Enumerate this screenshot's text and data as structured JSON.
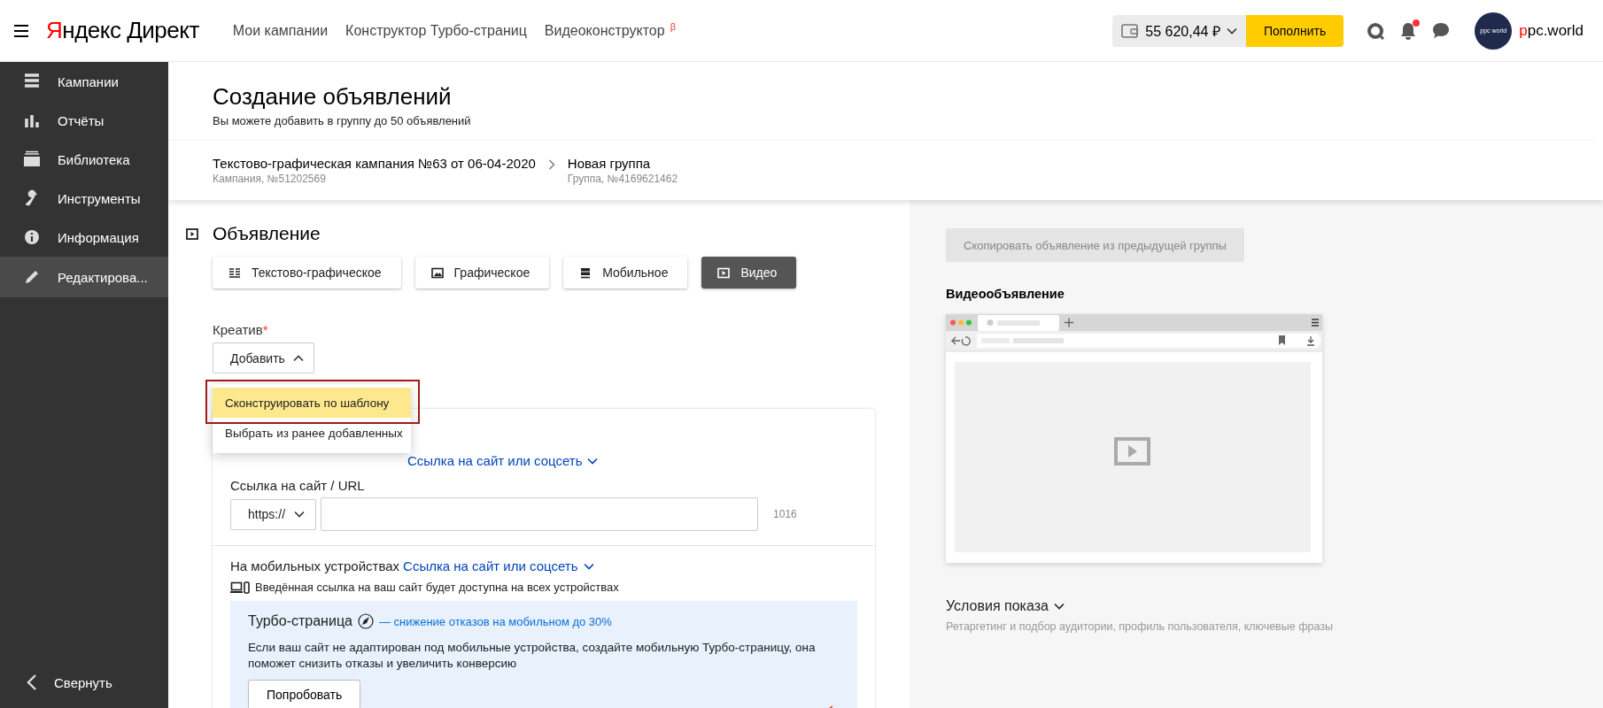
{
  "header": {
    "logo": {
      "accent": "Я",
      "rest": "ндекс Директ"
    },
    "nav": [
      {
        "label": "Мои кампании"
      },
      {
        "label": "Конструктор Турбо-страниц"
      },
      {
        "label": "Видеоконструктор",
        "beta": "β"
      }
    ],
    "balance": "55 620,44 ₽",
    "topup_button": "Пополнить",
    "notifications_unread": true,
    "avatar_text": "ppc world",
    "user": {
      "accent": "p",
      "rest": "pc.world"
    }
  },
  "sidebar": {
    "items": [
      {
        "label": "Кампании",
        "selected": false
      },
      {
        "label": "Отчёты",
        "selected": false
      },
      {
        "label": "Библиотека",
        "selected": false
      },
      {
        "label": "Инструменты",
        "selected": false
      },
      {
        "label": "Информация",
        "selected": false
      },
      {
        "label": "Редактирова...",
        "selected": true
      }
    ],
    "collapse": "Свернуть"
  },
  "page": {
    "title": "Создание объявлений",
    "subtitle": "Вы можете добавить в группу до 50 объявлений",
    "breadcrumbs": [
      {
        "title": "Текстово-графическая кампания №63 от 06-04-2020",
        "sub": "Кампания, №51202569"
      },
      {
        "title": "Новая группа",
        "sub": "Группа, №4169621462"
      }
    ]
  },
  "ad": {
    "title": "Объявление",
    "types": [
      {
        "label": "Текстово-графическое",
        "selected": false
      },
      {
        "label": "Графическое",
        "selected": false
      },
      {
        "label": "Мобильное",
        "selected": false
      },
      {
        "label": "Видео",
        "selected": true
      }
    ],
    "creative": {
      "label": "Креатив",
      "required_mark": "*",
      "button": "Добавить",
      "expanded": true,
      "menu": [
        {
          "label": "Сконструировать по шаблону",
          "selected": true,
          "outlined": true
        },
        {
          "label": "Выбрать из ранее добавленных",
          "selected": false,
          "outlined": false
        }
      ]
    },
    "desktop": {
      "link": "Ссылка на сайт или соцсеть",
      "url_label": "Ссылка на сайт / URL",
      "protocol": "https://",
      "counter": "1016"
    },
    "mobile": {
      "label": "На мобильных устройствах",
      "link": "Ссылка на сайт или соцсеть",
      "info": "Введённая ссылка на ваш сайт будет доступна на всех устройствах",
      "turbo": {
        "title": "Турбо-страница",
        "tagline": "— снижение отказов на мобильном до 30%",
        "text": "Если ваш сайт не адаптирован под мобильные устройства, создайте мобильную Турбо-страницу, она поможет снизить отказы и увеличить конверсию",
        "button": "Попробовать"
      }
    }
  },
  "preview": {
    "copy_button": {
      "label": "Скопировать объявление из предыдущей группы",
      "disabled": true
    },
    "title": "Видеообъявление",
    "conditions": {
      "title": "Условия показа",
      "text": "Ретаргетинг и подбор аудитории, профиль пользователя, ключевые фразы"
    }
  }
}
